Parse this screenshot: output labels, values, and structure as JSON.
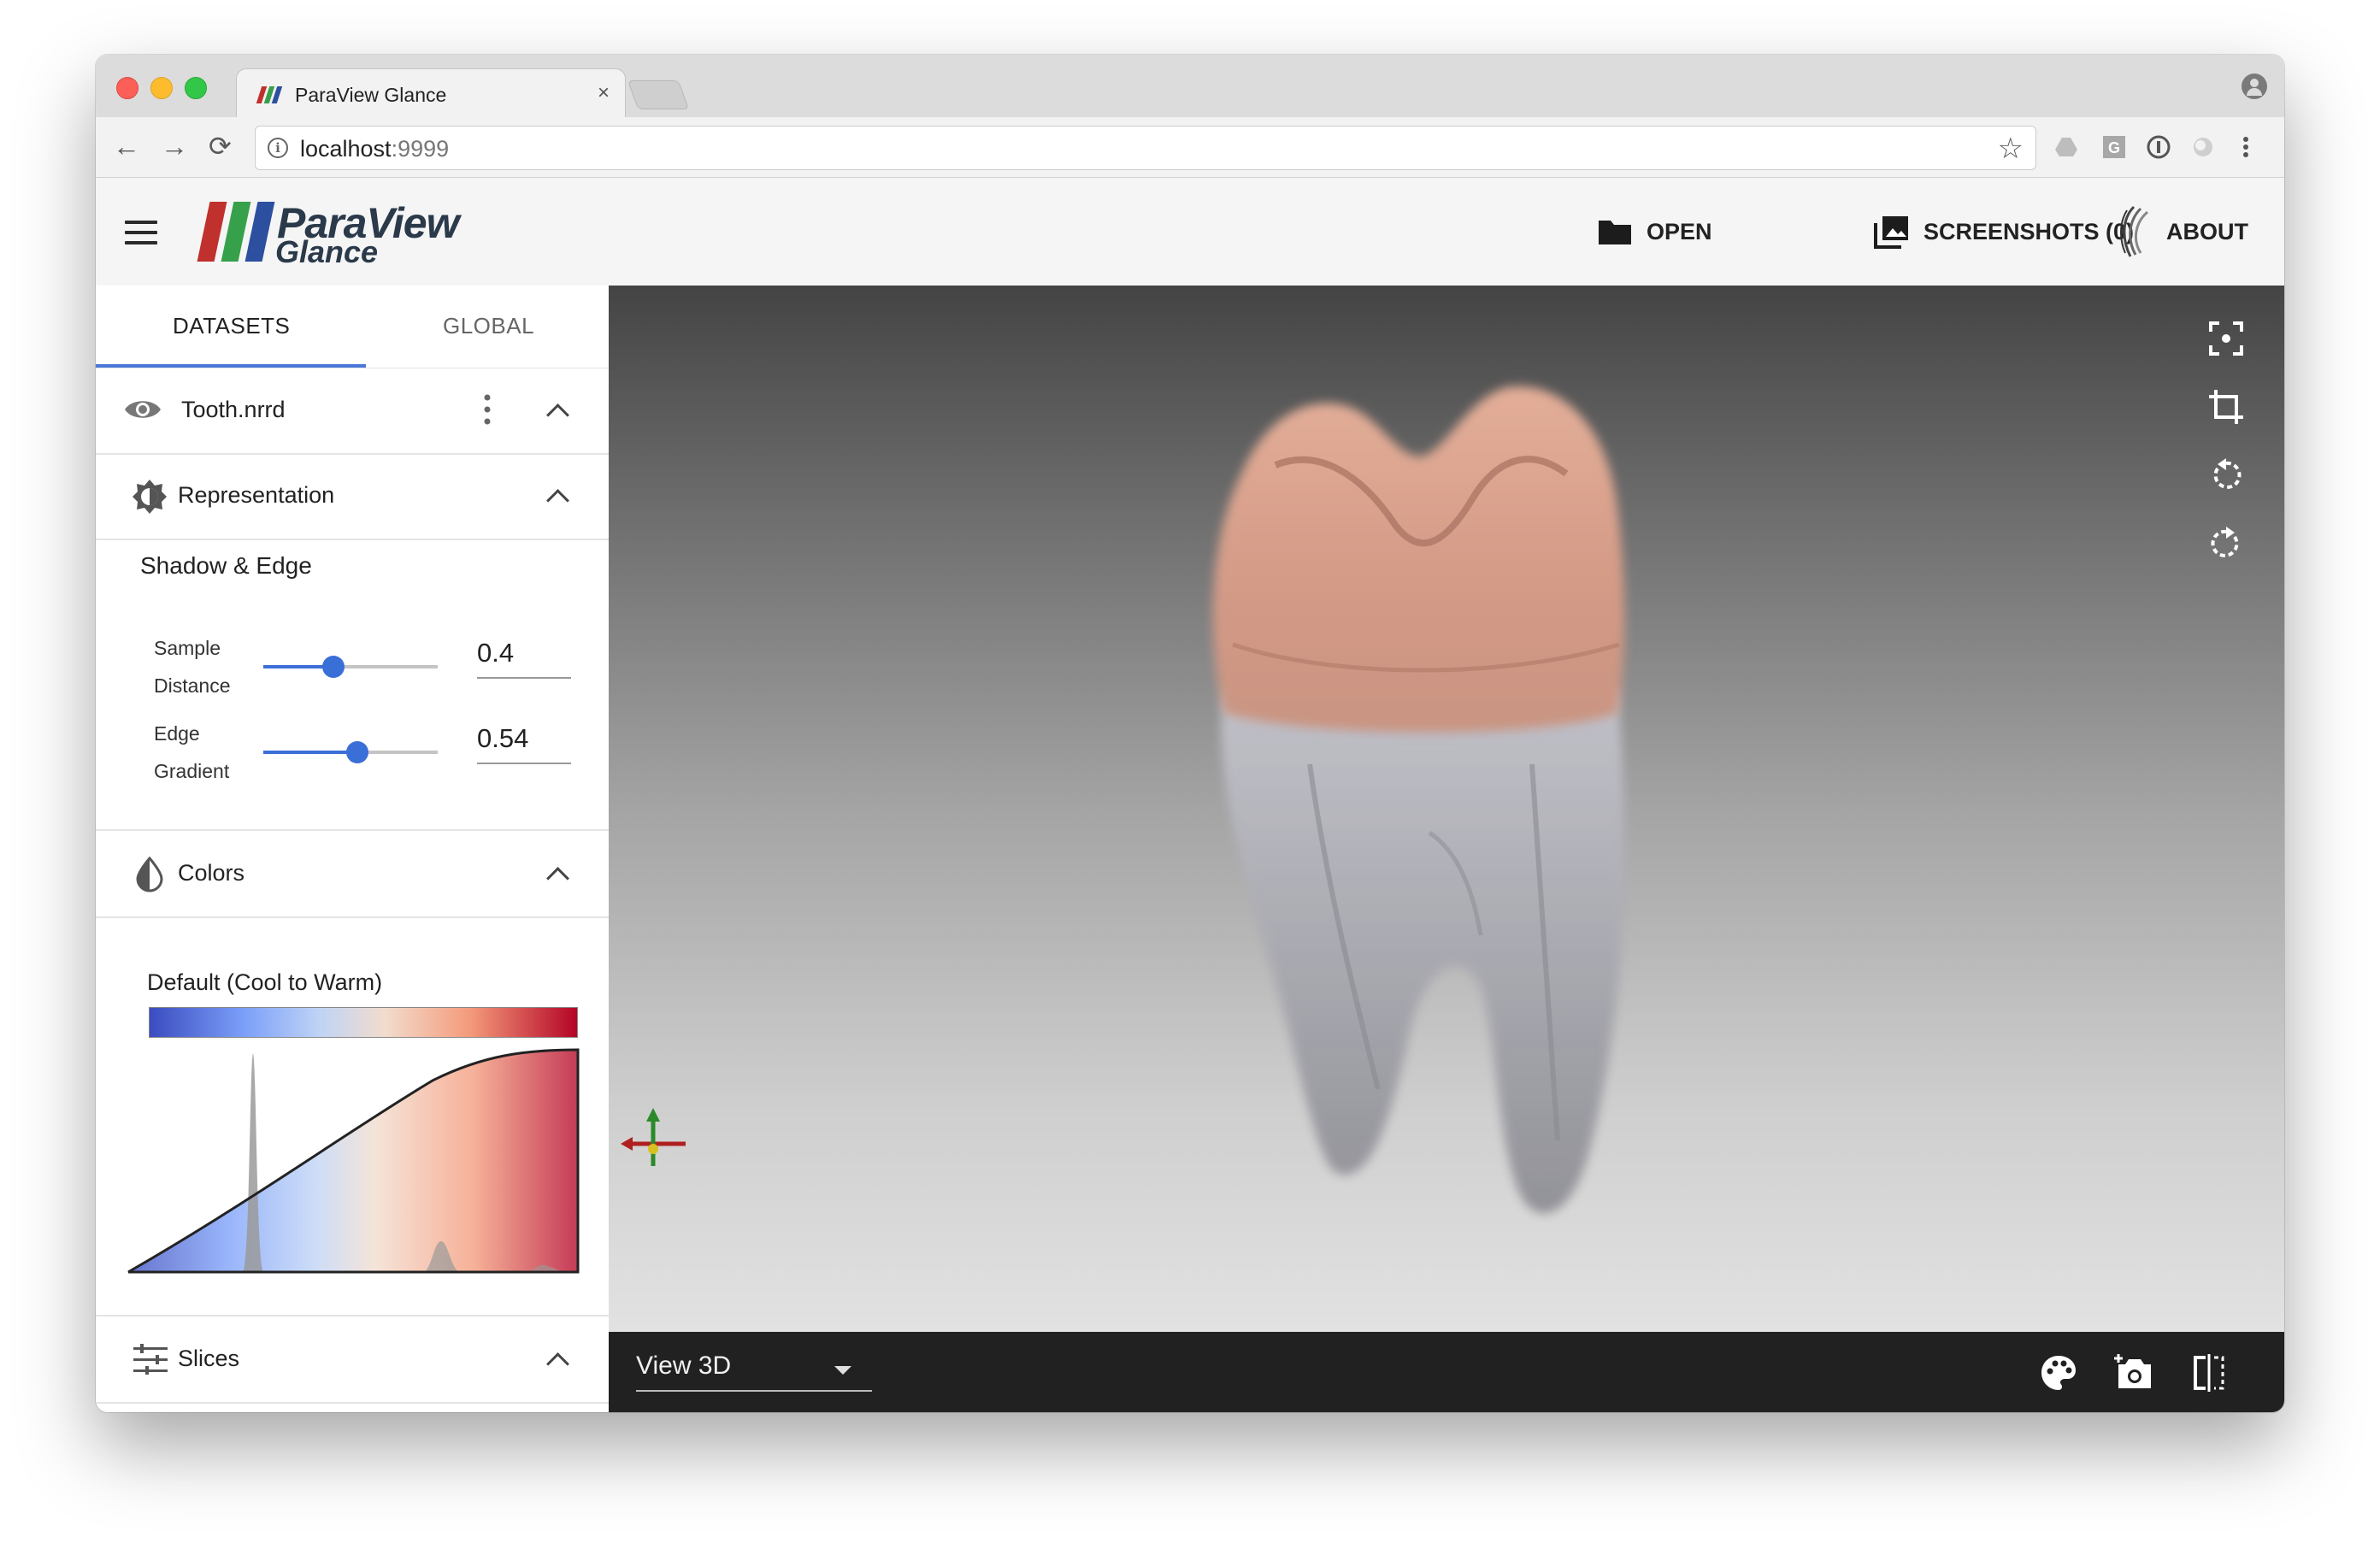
{
  "browser": {
    "tab_title": "ParaView Glance",
    "tab_close": "×",
    "url_host": "localhost",
    "url_port": ":9999",
    "nav_back": "←",
    "nav_forward": "→",
    "nav_reload": "⟳",
    "star": "☆",
    "info": "i"
  },
  "app": {
    "logo_para": "ParaView",
    "logo_glance": "Glance",
    "logo_colors": [
      "#c0302c",
      "#36a04a",
      "#2c4fa0"
    ],
    "open_label": "OPEN",
    "screenshots_label": "SCREENSHOTS (0)",
    "about_label": "ABOUT"
  },
  "sidebar": {
    "tabs": [
      {
        "label": "DATASETS",
        "active": true
      },
      {
        "label": "GLOBAL",
        "active": false
      }
    ],
    "dataset_name": "Tooth.nrrd",
    "representation_label": "Representation",
    "shadow_edge_title": "Shadow & Edge",
    "sliders": [
      {
        "label_line1": "Sample",
        "label_line2": "Distance",
        "value": "0.4",
        "fraction": 0.4
      },
      {
        "label_line1": "Edge",
        "label_line2": "Gradient",
        "value": "0.54",
        "fraction": 0.54
      }
    ],
    "colors_label": "Colors",
    "colormap_name": "Default (Cool to Warm)",
    "slices_label": "Slices"
  },
  "viewport": {
    "view_type": "View 3D"
  },
  "colors": {
    "accent": "#3a6fd8",
    "viewbar_bg": "#212121",
    "tooth_crown": "#d39a86",
    "tooth_root": "#a9a9b1"
  }
}
